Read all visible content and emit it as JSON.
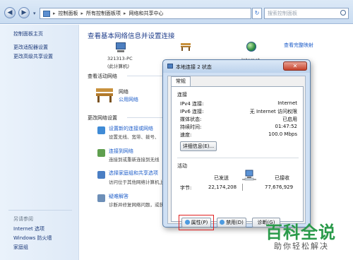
{
  "address_bar": {
    "crumbs": [
      "控制面板",
      "所有控制面板项",
      "网络和共享中心"
    ],
    "search_placeholder": "搜索控制面板",
    "separator": "▸"
  },
  "sidebar": {
    "items": [
      {
        "label": "控制面板主页"
      },
      {
        "label": "更改适配器设置"
      },
      {
        "label": "更改高级共享设置"
      }
    ],
    "see_also_heading": "另请参阅",
    "see_also": [
      {
        "label": "Internet 选项"
      },
      {
        "label": "Windows 防火墙"
      },
      {
        "label": "家庭组"
      }
    ]
  },
  "main": {
    "title": "查看基本网络信息并设置连接",
    "see_full_map": "查看完整映射",
    "map": {
      "computer_name": "321313-PC",
      "computer_sub": "(此计算机)",
      "internet": "Internet"
    },
    "active_networks_heading": "查看活动网络",
    "network": {
      "name": "网络",
      "type": "公用网络"
    },
    "change_settings_heading": "更改网络设置",
    "tasks": [
      {
        "title": "设置新的连接或网络",
        "desc": "设置无线、宽带、拨号、"
      },
      {
        "title": "连接到网络",
        "desc": "连接到或重新连接到无线"
      },
      {
        "title": "选择家庭组和共享选项",
        "desc": "访问位于其他网络计算机上"
      },
      {
        "title": "疑难解答",
        "desc": "诊断并修复网络问题，或获"
      }
    ]
  },
  "dialog": {
    "title": "本地连接 2 状态",
    "close": "✕",
    "tab": "常规",
    "connection_heading": "连接",
    "fields": [
      {
        "key": "IPv4 连接:",
        "value": "Internet"
      },
      {
        "key": "IPv6 连接:",
        "value": "无 Internet 访问权限"
      },
      {
        "key": "媒体状态:",
        "value": "已启用"
      },
      {
        "key": "持续时间:",
        "value": "01:47:52"
      },
      {
        "key": "速度:",
        "value": "100.0 Mbps"
      }
    ],
    "details_button": "详细信息(E)...",
    "activity_heading": "活动",
    "sent_label": "已发送",
    "received_label": "已接收",
    "bytes_label": "字节:",
    "bytes_sent": "22,174,208",
    "bytes_received": "77,676,929",
    "buttons": {
      "properties": "属性(P)",
      "disable": "禁用(D)",
      "diagnose": "诊断(G)"
    }
  },
  "watermark": {
    "logo": "百科全说",
    "sub": "助你轻松解决"
  },
  "colors": {
    "link": "#1c5cc9",
    "highlight": "#e02020",
    "watermark": "#2a9a4a"
  }
}
